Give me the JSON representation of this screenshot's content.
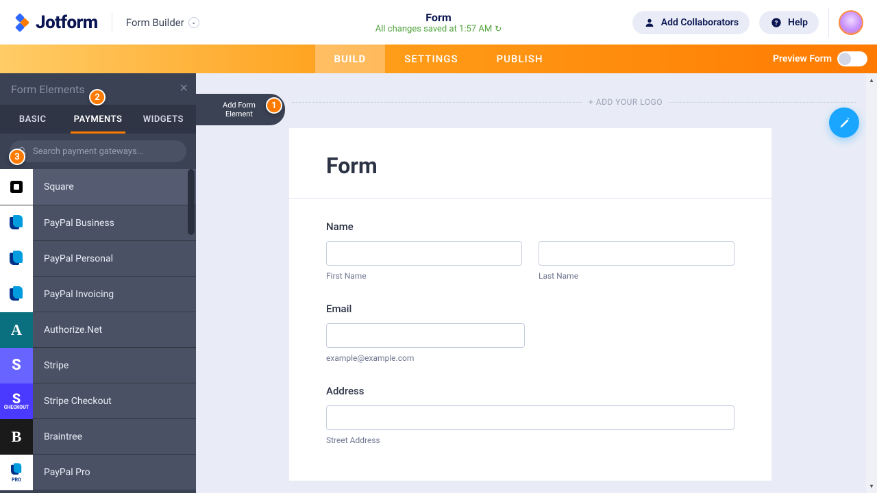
{
  "header": {
    "logo_text": "Jotform",
    "breadcrumb": "Form Builder",
    "form_title": "Form",
    "save_status": "All changes saved at 1:57 AM",
    "collab_label": "Add Collaborators",
    "help_label": "Help"
  },
  "subnav": {
    "tabs": [
      "BUILD",
      "SETTINGS",
      "PUBLISH"
    ],
    "active": 0,
    "preview_label": "Preview Form"
  },
  "sidebar": {
    "title": "Form Elements",
    "tabs": [
      "BASIC",
      "PAYMENTS",
      "WIDGETS"
    ],
    "search_placeholder": "Search payment gateways...",
    "gateways": [
      {
        "label": "Square",
        "icon_class": "i-square",
        "glyph": "☐"
      },
      {
        "label": "PayPal Business",
        "icon_class": "i-ppb",
        "glyph": "pp"
      },
      {
        "label": "PayPal Personal",
        "icon_class": "i-ppp",
        "glyph": "pp"
      },
      {
        "label": "PayPal Invoicing",
        "icon_class": "i-ppi",
        "glyph": "pp"
      },
      {
        "label": "Authorize.Net",
        "icon_class": "i-auth",
        "glyph": "A"
      },
      {
        "label": "Stripe",
        "icon_class": "i-stripe",
        "glyph": "S"
      },
      {
        "label": "Stripe Checkout",
        "icon_class": "i-stripec",
        "glyph": "S"
      },
      {
        "label": "Braintree",
        "icon_class": "i-brain",
        "glyph": "B"
      },
      {
        "label": "PayPal Pro",
        "icon_class": "i-pppro",
        "glyph": "pp"
      }
    ]
  },
  "canvas": {
    "add_element_l1": "Add Form",
    "add_element_l2": "Element",
    "add_logo": "+ ADD YOUR LOGO",
    "form_heading": "Form",
    "name_label": "Name",
    "first_sub": "First Name",
    "last_sub": "Last Name",
    "email_label": "Email",
    "email_sub": "example@example.com",
    "address_label": "Address",
    "street_sub": "Street Address"
  },
  "markers": {
    "m1": "1",
    "m2": "2",
    "m3": "3"
  }
}
